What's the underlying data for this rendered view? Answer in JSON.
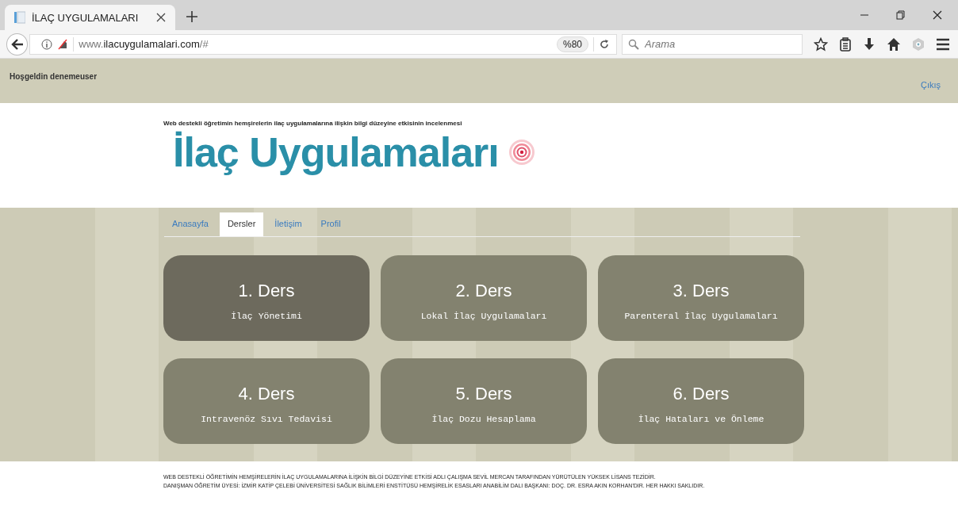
{
  "browser": {
    "tab_title": "İLAÇ UYGULAMALARI",
    "url_host": "www.",
    "url_domain": "ilacuygulamalari.com",
    "url_path": "/#",
    "zoom": "%80",
    "search_placeholder": "Arama"
  },
  "header": {
    "greeting": "Hoşgeldin denemeuser",
    "logout": "Çıkış"
  },
  "subtitle": "Web destekli öğretimin hemşirelerin ilaç uygulamalarına ilişkin bilgi düzeyine etkisinin incelenmesi",
  "logo": "İlaç Uygulamaları",
  "tabs": [
    {
      "label": "Anasayfa",
      "selected": false
    },
    {
      "label": "Dersler",
      "selected": true
    },
    {
      "label": "İletişim",
      "selected": false
    },
    {
      "label": "Profil",
      "selected": false
    }
  ],
  "lessons": [
    {
      "title": "1. Ders",
      "subtitle": "İlaç Yönetimi",
      "selected": true
    },
    {
      "title": "2. Ders",
      "subtitle": "Lokal İlaç Uygulamaları",
      "selected": false
    },
    {
      "title": "3. Ders",
      "subtitle": "Parenteral İlaç Uygulamaları",
      "selected": false
    },
    {
      "title": "4. Ders",
      "subtitle": "Intravenöz Sıvı Tedavisi",
      "selected": false
    },
    {
      "title": "5. Ders",
      "subtitle": "İlaç Dozu Hesaplama",
      "selected": false
    },
    {
      "title": "6. Ders",
      "subtitle": "İlaç Hataları ve Önleme",
      "selected": false
    }
  ],
  "footer": [
    "WEB DESTEKLİ ÖĞRETİMİN HEMŞİRELERİN İLAÇ UYGULAMALARINA İLİŞKİN BİLGİ DÜZEYİNE ETKİSİ ADLI ÇALIŞMA SEVİL MERCAN TARAFINDAN YÜRÜTÜLEN YÜKSEK LİSANS TEZİDİR.",
    "DANIŞMAN ÖĞRETİM ÜYESİ: İZMİR KATİP ÇELEBİ ÜNİVERSİTESİ SAĞLIK BİLİMLERİ ENSTİTÜSÜ HEMŞİRELİK ESASLARI ANABİLİM DALI BAŞKANI: DOÇ. DR. ESRA AKIN KORHAN'DIR. HER HAKKI SAKLIDIR."
  ]
}
